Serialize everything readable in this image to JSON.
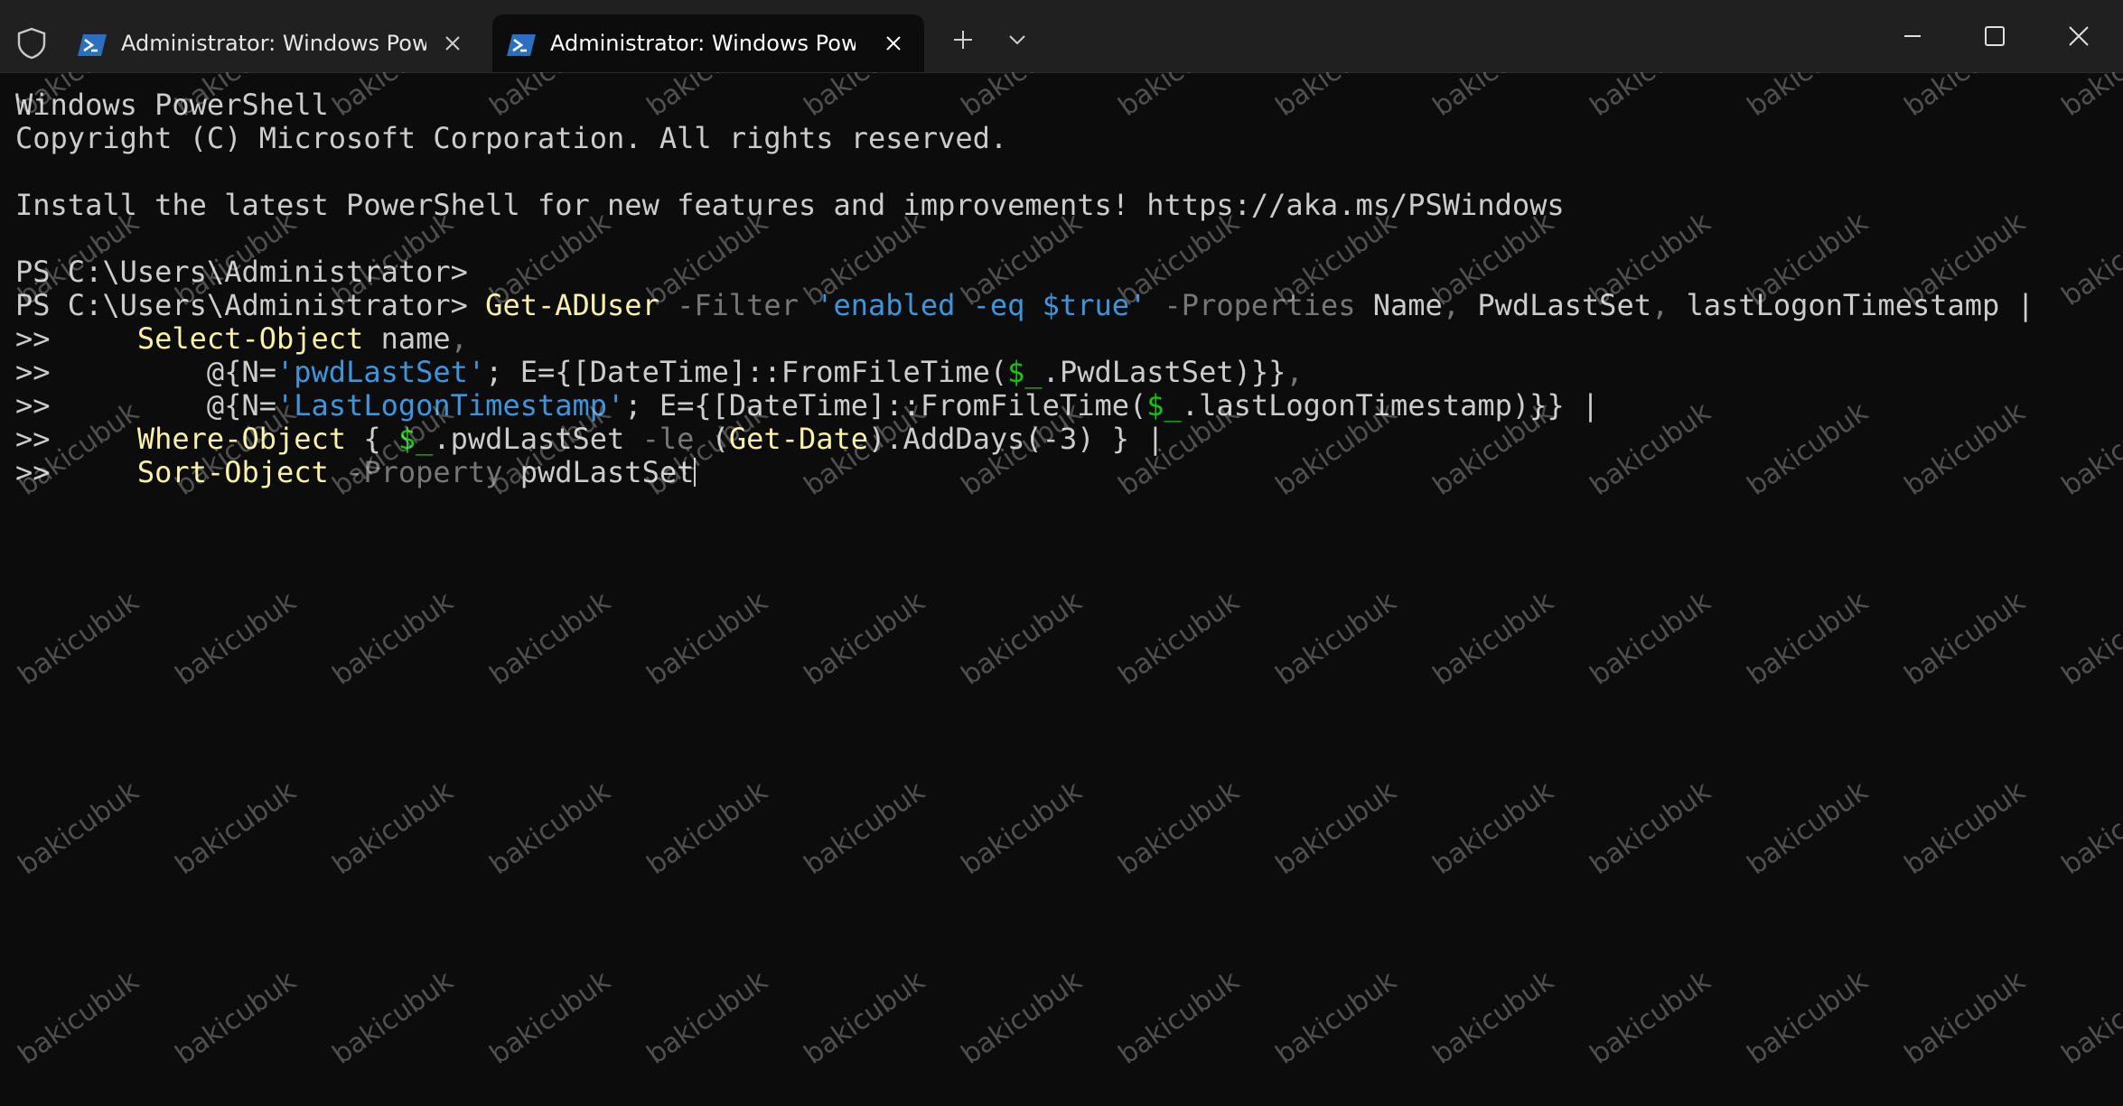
{
  "window": {
    "tabs": [
      {
        "title": "Administrator: Windows PowerShell",
        "active": false
      },
      {
        "title": "Administrator: Windows PowerShell",
        "active": true
      }
    ]
  },
  "terminal": {
    "lines": [
      [
        {
          "t": "Windows PowerShell",
          "c": "plain"
        }
      ],
      [
        {
          "t": "Copyright (C) Microsoft Corporation. All rights reserved.",
          "c": "plain"
        }
      ],
      [],
      [
        {
          "t": "Install the latest PowerShell for new features and improvements! https://aka.ms/PSWindows",
          "c": "plain"
        }
      ],
      [],
      [
        {
          "t": "PS C:\\Users\\Administrator>",
          "c": "plain"
        }
      ],
      [
        {
          "t": "PS C:\\Users\\Administrator> ",
          "c": "plain"
        },
        {
          "t": "Get-ADUser",
          "c": "cmd"
        },
        {
          "t": " -Filter ",
          "c": "param"
        },
        {
          "t": "'enabled -eq ",
          "c": "str"
        },
        {
          "t": "$true",
          "c": "str"
        },
        {
          "t": "'",
          "c": "str"
        },
        {
          "t": " -Properties",
          "c": "param"
        },
        {
          "t": " Name",
          "c": "plain"
        },
        {
          "t": ",",
          "c": "param"
        },
        {
          "t": " PwdLastSet",
          "c": "plain"
        },
        {
          "t": ",",
          "c": "param"
        },
        {
          "t": " lastLogonTimestamp |",
          "c": "plain"
        }
      ],
      [
        {
          "t": ">> ",
          "c": "plain"
        },
        {
          "t": "    Select-Object",
          "c": "cmd"
        },
        {
          "t": " name",
          "c": "plain"
        },
        {
          "t": ",",
          "c": "param"
        }
      ],
      [
        {
          "t": ">> ",
          "c": "plain"
        },
        {
          "t": "        @{N=",
          "c": "plain"
        },
        {
          "t": "'pwdLastSet'",
          "c": "str"
        },
        {
          "t": "; E={[DateTime]::FromFileTime(",
          "c": "plain"
        },
        {
          "t": "$_",
          "c": "var"
        },
        {
          "t": ".PwdLastSet)}}",
          "c": "plain"
        },
        {
          "t": ",",
          "c": "param"
        }
      ],
      [
        {
          "t": ">> ",
          "c": "plain"
        },
        {
          "t": "        @{N=",
          "c": "plain"
        },
        {
          "t": "'LastLogonTimestamp'",
          "c": "str"
        },
        {
          "t": "; E={[DateTime]::FromFileTime(",
          "c": "plain"
        },
        {
          "t": "$_",
          "c": "var"
        },
        {
          "t": ".lastLogonTimestamp)}} |",
          "c": "plain"
        }
      ],
      [
        {
          "t": ">> ",
          "c": "plain"
        },
        {
          "t": "    Where-Object",
          "c": "cmd"
        },
        {
          "t": " { ",
          "c": "plain"
        },
        {
          "t": "$_",
          "c": "var"
        },
        {
          "t": ".pwdLastSet ",
          "c": "plain"
        },
        {
          "t": "-le",
          "c": "param"
        },
        {
          "t": " (",
          "c": "plain"
        },
        {
          "t": "Get-Date",
          "c": "cmd"
        },
        {
          "t": ").AddDays(-3) } |",
          "c": "plain"
        }
      ],
      [
        {
          "t": ">> ",
          "c": "plain"
        },
        {
          "t": "    Sort-Object",
          "c": "cmd"
        },
        {
          "t": " -Property",
          "c": "param"
        },
        {
          "t": " pwdLastSet",
          "c": "plain"
        }
      ]
    ],
    "cursor_line": 11
  },
  "watermark": "bakicubuk",
  "colors": {
    "background": "#0c0c0c",
    "titlebar": "#202020",
    "foreground": "#cccccc",
    "command": "#f9f1a5",
    "parameter": "#767676",
    "string": "#3a96dd",
    "variable": "#16c60c"
  }
}
